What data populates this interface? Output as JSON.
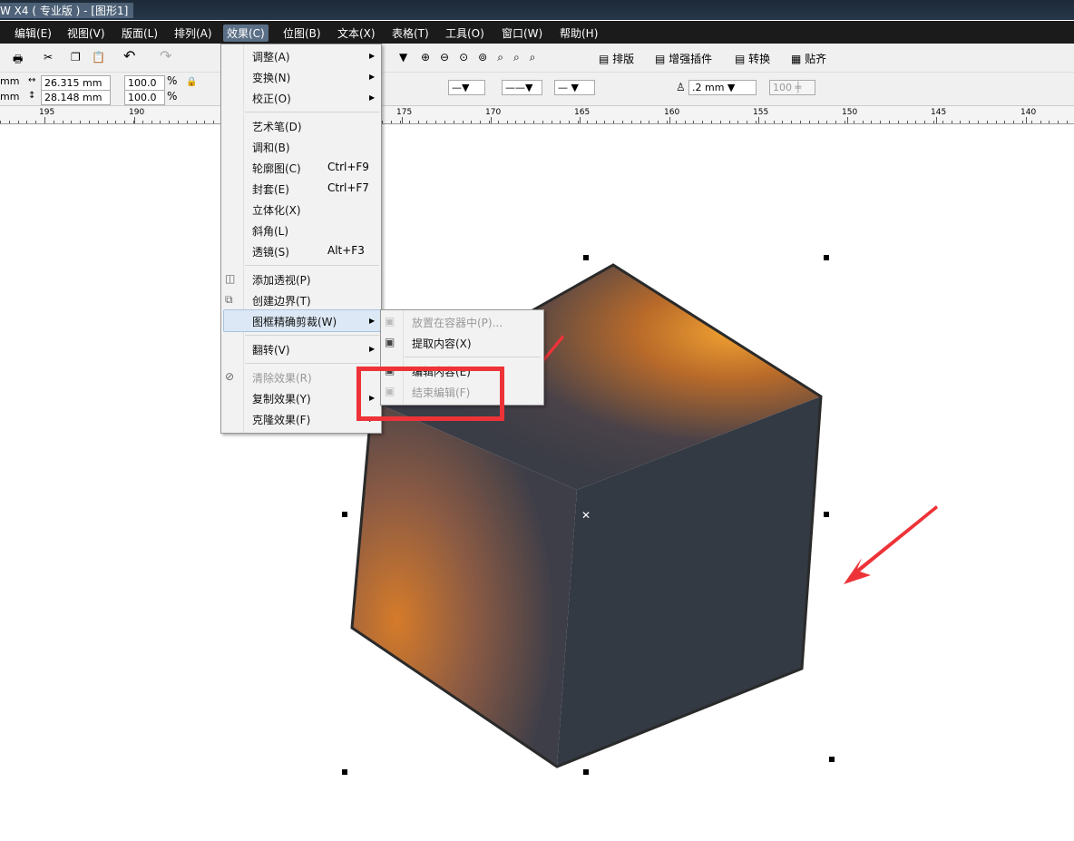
{
  "window": {
    "title": "W X4 ( 专业版 ) - [图形1]"
  },
  "menubar": [
    "编辑(E)",
    "视图(V)",
    "版面(L)",
    "排列(A)",
    "效果(C)",
    "位图(B)",
    "文本(X)",
    "表格(T)",
    "工具(O)",
    "窗口(W)",
    "帮助(H)"
  ],
  "toolbar": {
    "plugins": [
      "排版",
      "增强插件",
      "转换",
      "贴齐"
    ]
  },
  "propbar": {
    "x_unit": "mm",
    "y_unit": "mm",
    "width": "26.315 mm",
    "height": "28.148 mm",
    "scale_x": "100.0",
    "scale_y": "100.0",
    "pct": "%",
    "outline_width": ".2 mm",
    "transparency": "100"
  },
  "ruler": {
    "labels": [
      "195",
      "190",
      "175",
      "170",
      "165",
      "160",
      "155",
      "150",
      "145",
      "140"
    ]
  },
  "effects_menu": {
    "items": [
      {
        "label": "调整(A)",
        "submenu": true
      },
      {
        "label": "变换(N)",
        "submenu": true
      },
      {
        "label": "校正(O)",
        "submenu": true
      },
      {
        "label": "艺术笔(D)"
      },
      {
        "label": "调和(B)"
      },
      {
        "label": "轮廓图(C)",
        "shortcut": "Ctrl+F9"
      },
      {
        "label": "封套(E)",
        "shortcut": "Ctrl+F7"
      },
      {
        "label": "立体化(X)"
      },
      {
        "label": "斜角(L)"
      },
      {
        "label": "透镜(S)",
        "shortcut": "Alt+F3"
      },
      {
        "label": "添加透视(P)"
      },
      {
        "label": "创建边界(T)"
      },
      {
        "label": "图框精确剪裁(W)",
        "submenu": true,
        "highlighted": true
      },
      {
        "label": "翻转(V)",
        "submenu": true
      },
      {
        "label": "清除效果(R)",
        "disabled": true
      },
      {
        "label": "复制效果(Y)",
        "submenu": true
      },
      {
        "label": "克隆效果(F)",
        "submenu": true
      }
    ]
  },
  "powerclip_submenu": {
    "items": [
      {
        "label": "放置在容器中(P)...",
        "disabled": true
      },
      {
        "label": "提取内容(X)"
      },
      {
        "label": "编辑内容(E)"
      },
      {
        "label": "结束编辑(F)",
        "disabled": true
      }
    ]
  },
  "colors": {
    "highlight": "#ee3338",
    "cube_dark": "#333a44",
    "cube_orange": "#e0892a"
  }
}
